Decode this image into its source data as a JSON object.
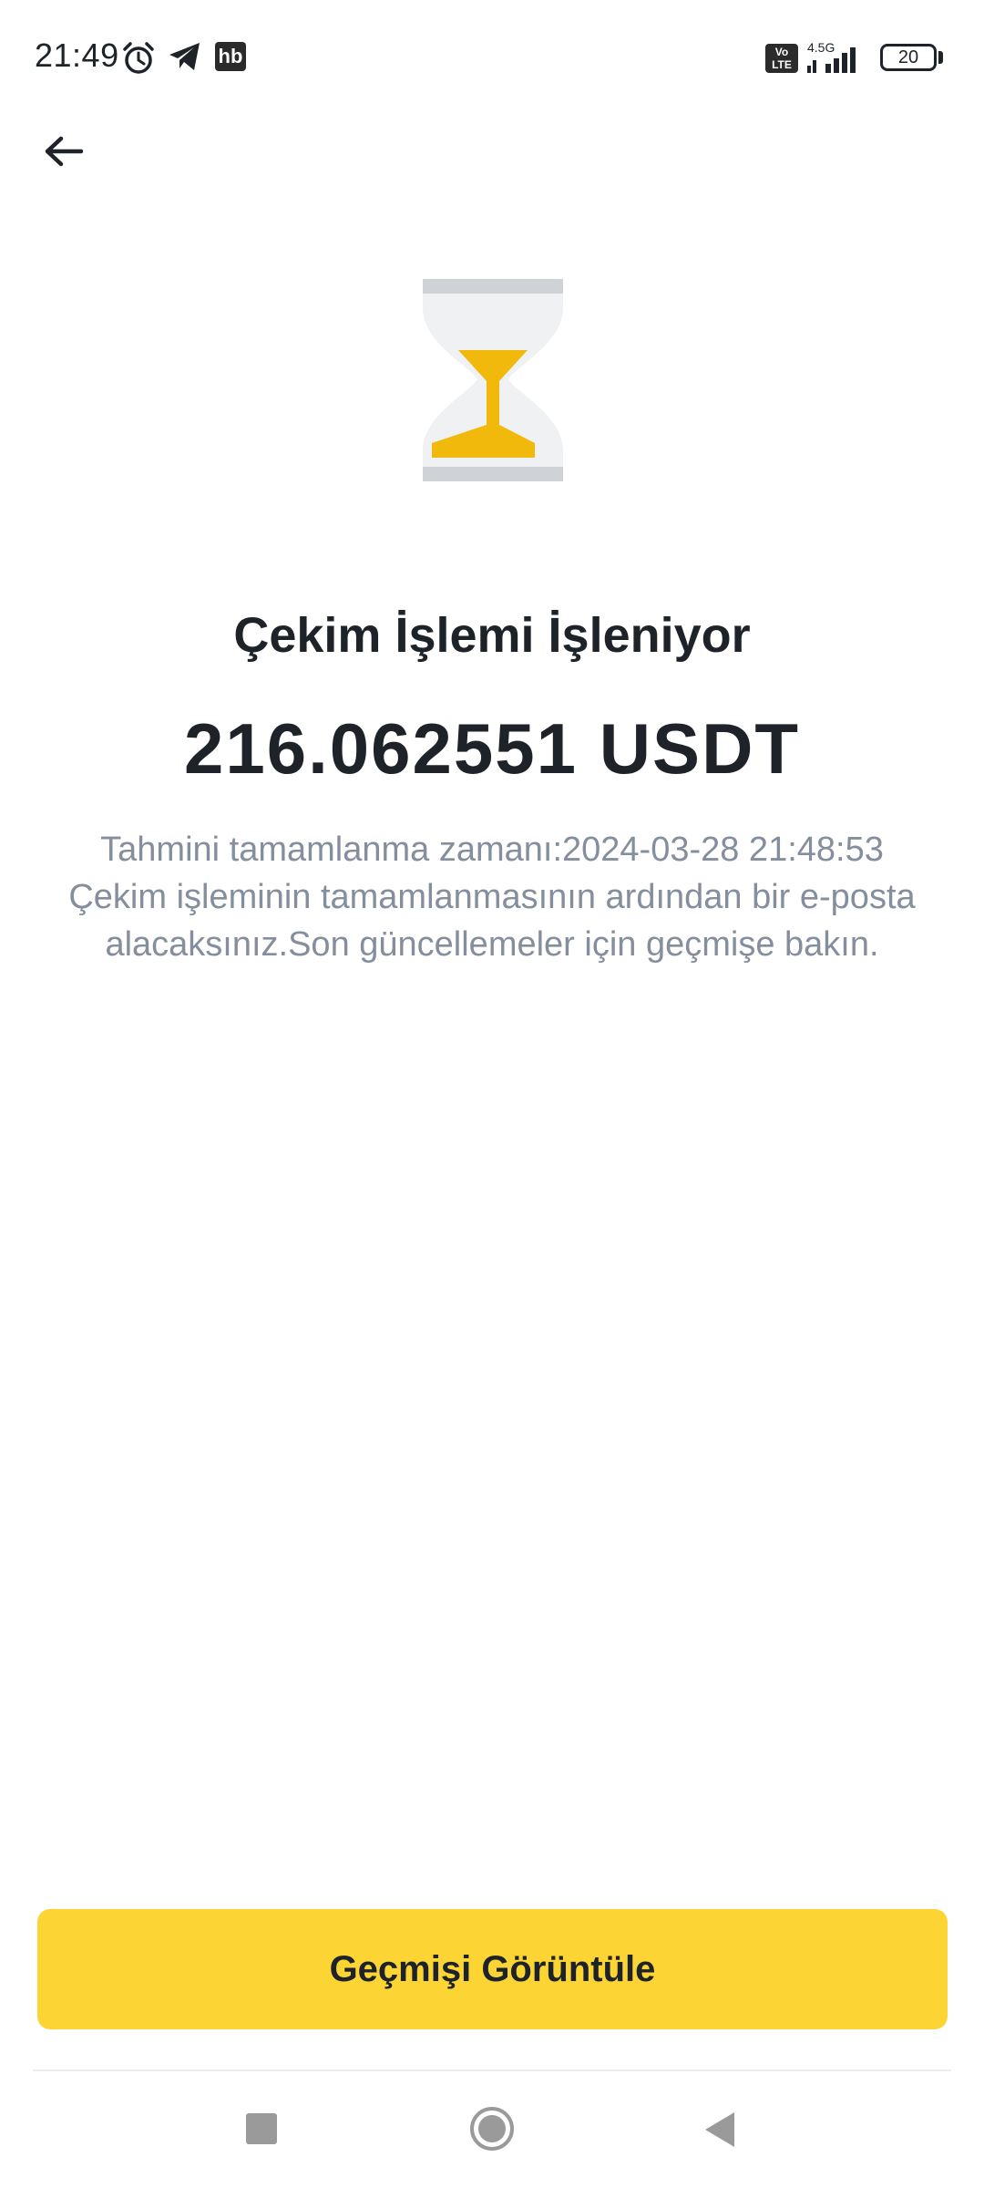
{
  "status_bar": {
    "time": "21:49",
    "network_type": "4.5G",
    "volte_label": "Vo LTE",
    "battery_level": "20",
    "icons": [
      "alarm-icon",
      "telegram-icon",
      "hb-app-icon",
      "volte-icon",
      "signal-icon",
      "battery-icon"
    ]
  },
  "header": {
    "back_icon": "arrow-left-icon"
  },
  "status": {
    "icon": "hourglass-icon",
    "title": "Çekim İşlemi İşleniyor",
    "amount": "216.062551 USDT",
    "info_lines": [
      "Tahmini tamamlanma zamanı:2024-03-28 21:48:53",
      "Çekim işleminin tamamlanmasının ardından bir e-posta",
      "alacaksınız.Son güncellemeler için geçmişe bakın."
    ]
  },
  "actions": {
    "view_history_label": "Geçmişi Görüntüle"
  },
  "colors": {
    "accent": "#fcd535",
    "hourglass_sand": "#f0b90b",
    "text_primary": "#1e2329",
    "text_secondary": "#848e9c"
  },
  "nav_bar": {
    "icons": [
      "recent-apps-icon",
      "home-icon",
      "back-triangle-icon"
    ]
  }
}
